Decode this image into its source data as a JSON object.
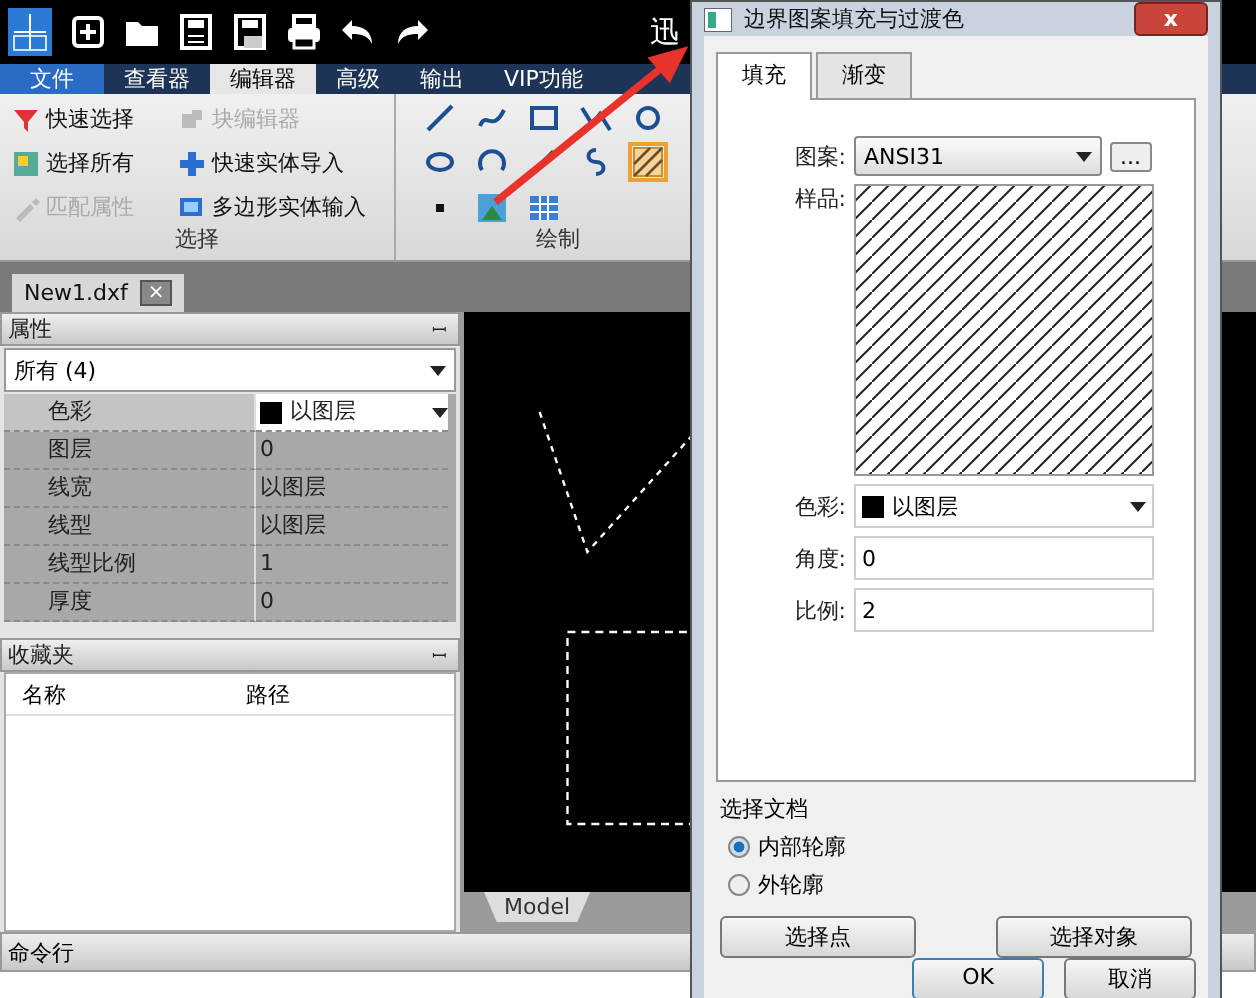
{
  "app": {
    "title": "迅"
  },
  "ribbon_tabs": [
    {
      "label": "文件",
      "kind": "file",
      "selected": false
    },
    {
      "label": "查看器",
      "kind": "tab",
      "selected": false
    },
    {
      "label": "编辑器",
      "kind": "tab",
      "selected": true
    },
    {
      "label": "高级",
      "kind": "tab",
      "selected": false
    },
    {
      "label": "输出",
      "kind": "tab",
      "selected": false
    },
    {
      "label": "VIP功能",
      "kind": "tab",
      "selected": false
    }
  ],
  "ribbon_groups": [
    {
      "label": "选择",
      "items": [
        {
          "label": "快速选择",
          "kind": "filter",
          "disabled": false
        },
        {
          "label": "块编辑器",
          "kind": "block",
          "disabled": true
        },
        {
          "label": "选择所有",
          "kind": "all",
          "disabled": false
        },
        {
          "label": "快速实体导入",
          "kind": "plus",
          "disabled": false
        },
        {
          "label": "匹配属性",
          "kind": "brush",
          "disabled": true
        },
        {
          "label": "多边形实体输入",
          "kind": "poly",
          "disabled": false
        }
      ]
    },
    {
      "label": "绘制"
    }
  ],
  "document_tab": {
    "label": "New1.dxf",
    "close": "×"
  },
  "properties_panel": {
    "title": "属性",
    "pin": "ꟷ",
    "filter": "所有 (4)",
    "rows": [
      {
        "name": "色彩",
        "value": "以图层",
        "kind": "color",
        "selected": true
      },
      {
        "name": "图层",
        "value": "0",
        "kind": "text",
        "selected": false
      },
      {
        "name": "线宽",
        "value": "以图层",
        "kind": "text",
        "selected": false
      },
      {
        "name": "线型",
        "value": "以图层",
        "kind": "text",
        "selected": false
      },
      {
        "name": "线型比例",
        "value": "1",
        "kind": "text",
        "selected": false
      },
      {
        "name": "厚度",
        "value": "0",
        "kind": "text",
        "selected": false
      }
    ]
  },
  "favorites_panel": {
    "title": "收藏夹",
    "pin": "ꟷ",
    "columns": [
      "名称",
      "路径"
    ]
  },
  "canvas": {
    "layout_tab": "Model"
  },
  "command_line": {
    "title": "命令行"
  },
  "dialog": {
    "title": "边界图案填充与过渡色",
    "close": "x",
    "tabs": [
      {
        "label": "填充",
        "selected": true
      },
      {
        "label": "渐变",
        "selected": false
      }
    ],
    "pattern_label": "图案:",
    "pattern": "ANSI31",
    "browse": "...",
    "sample_label": "样品:",
    "color_label": "色彩:",
    "color_setting": "以图层",
    "angle_label": "角度:",
    "angle": "0",
    "scale_label": "比例:",
    "scale": "2",
    "boundary": {
      "title": "选择文档",
      "options": [
        {
          "label": "内部轮廓",
          "selected": true
        },
        {
          "label": "外轮廓",
          "selected": false
        }
      ]
    },
    "pick_buttons": [
      "选择点",
      "选择对象"
    ],
    "buttons": [
      "OK",
      "取消"
    ]
  }
}
